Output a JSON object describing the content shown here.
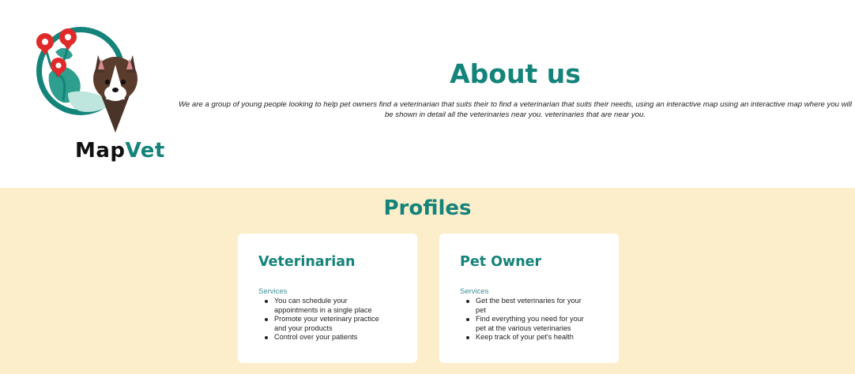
{
  "brand": {
    "logo_name_part1": "Map",
    "logo_name_part2": "Vet",
    "colors": {
      "primary": "#14837a",
      "accent_bg": "#fdeecb",
      "pin_red": "#e02a2a"
    }
  },
  "about": {
    "title": "About us",
    "text": "We are a group of young people looking to help pet owners find a veterinarian that suits their to find a veterinarian that suits their needs, using an interactive map using an interactive map where you will be shown in detail all the veterinaries near you. veterinaries that are near you."
  },
  "profiles": {
    "title": "Profiles",
    "cards": [
      {
        "title": "Veterinarian",
        "label": "Services",
        "items": [
          "You can schedule your appointments in a single place",
          "Promote your veterinary practice and your products",
          "Control over your patients"
        ]
      },
      {
        "title": "Pet Owner",
        "label": "Services",
        "items": [
          "Get the best veterinaries for your pet",
          "Find everything you need for your pet at the various veterinaries",
          "Keep track of your pet's health"
        ]
      }
    ]
  }
}
